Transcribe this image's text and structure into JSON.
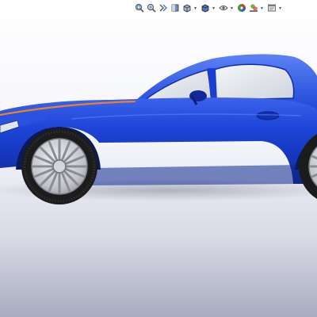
{
  "viewport": {
    "background_top": "#ffffff",
    "background_bottom": "#a9acbf",
    "model_name": "",
    "model_color": "#1b3fd6",
    "stripe_color": "#e8832c",
    "glass_color": "#e6e9ee",
    "tire_color": "#1c1c1c",
    "rim_color": "#c9cbd0"
  },
  "toolbar": {
    "buttons": [
      {
        "icon": "zoom-to-fit-icon",
        "has_dropdown": false
      },
      {
        "icon": "zoom-to-area-icon",
        "has_dropdown": false
      },
      {
        "icon": "previous-view-icon",
        "has_dropdown": false
      },
      {
        "icon": "section-view-icon",
        "has_dropdown": false
      },
      {
        "icon": "view-orientation-icon",
        "has_dropdown": true
      },
      {
        "icon": "display-style-icon",
        "has_dropdown": true
      },
      {
        "icon": "hide-show-items-icon",
        "has_dropdown": true
      },
      {
        "icon": "edit-appearance-icon",
        "has_dropdown": false
      },
      {
        "icon": "apply-scene-icon",
        "has_dropdown": true
      },
      {
        "icon": "view-settings-icon",
        "has_dropdown": true
      }
    ]
  }
}
